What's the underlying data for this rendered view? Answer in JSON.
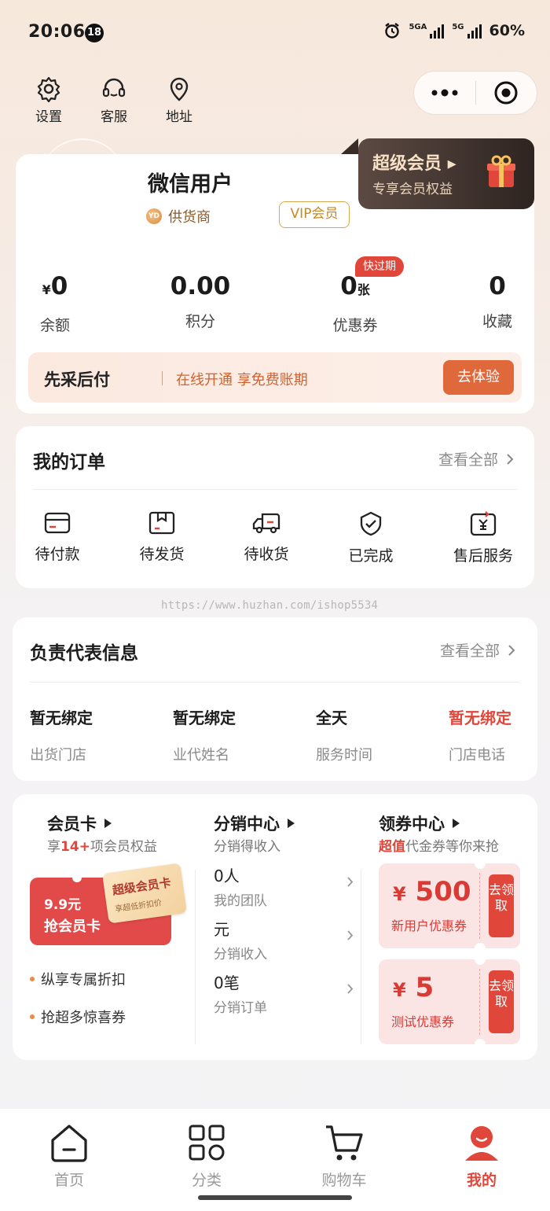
{
  "status_bar": {
    "time": "20:06",
    "badge": "18",
    "battery": "60%",
    "signal_label_1": "5GA",
    "signal_label_2": "5G"
  },
  "top_icons": [
    {
      "label": "设置",
      "icon": "gear-icon"
    },
    {
      "label": "客服",
      "icon": "headset-icon"
    },
    {
      "label": "地址",
      "icon": "location-pin-icon"
    }
  ],
  "user": {
    "name": "微信用户",
    "role": "供货商",
    "role_badge": "YD",
    "vip_tag": "VIP会员"
  },
  "super_vip": {
    "title": "超级会员",
    "subtitle": "专享会员权益"
  },
  "stats": [
    {
      "prefix": "¥",
      "value": "0",
      "suffix": "",
      "label": "余额"
    },
    {
      "prefix": "",
      "value": "0.00",
      "suffix": "",
      "label": "积分"
    },
    {
      "prefix": "",
      "value": "0",
      "suffix": "张",
      "label": "优惠券"
    },
    {
      "prefix": "",
      "value": "0",
      "suffix": "",
      "label": "收藏"
    }
  ],
  "expire_badge": "快过期",
  "pay_later": {
    "brand": "先采后付",
    "text": "在线开通 享免费账期",
    "button": "去体验"
  },
  "orders": {
    "title": "我的订单",
    "view_all": "查看全部",
    "items": [
      {
        "label": "待付款",
        "icon": "card-icon"
      },
      {
        "label": "待发货",
        "icon": "package-icon"
      },
      {
        "label": "待收货",
        "icon": "truck-icon"
      },
      {
        "label": "已完成",
        "icon": "shield-check-icon"
      },
      {
        "label": "售后服务",
        "icon": "refund-icon"
      }
    ]
  },
  "watermark": "https://www.huzhan.com/ishop5534",
  "representative": {
    "title": "负责代表信息",
    "view_all": "查看全部",
    "fields": [
      {
        "value": "暂无绑定",
        "label": "出货门店",
        "highlight": false
      },
      {
        "value": "暂无绑定",
        "label": "业代姓名",
        "highlight": false
      },
      {
        "value": "全天",
        "label": "服务时间",
        "highlight": false
      },
      {
        "value": "暂无绑定",
        "label": "门店电话",
        "highlight": true
      }
    ]
  },
  "member_card": {
    "title": "会员卡",
    "sub_prefix": "享",
    "sub_highlight": "14+",
    "sub_suffix": "项会员权益",
    "price": "9.9元",
    "grab": "抢会员卡",
    "sticker_title": "超级会员卡",
    "sticker_sub": "享超低折扣价",
    "perks": [
      "纵享专属折扣",
      "抢超多惊喜券"
    ]
  },
  "distribution": {
    "title": "分销中心",
    "subtitle": "分销得收入",
    "rows": [
      {
        "value": "0人",
        "label": "我的团队"
      },
      {
        "value": "元",
        "label": "分销收入"
      },
      {
        "value": "0笔",
        "label": "分销订单"
      }
    ]
  },
  "coupon_center": {
    "title": "领券中心",
    "sub_highlight": "超值",
    "sub_suffix": "代金券等你来抢",
    "coupons": [
      {
        "currency": "¥",
        "amount": "500",
        "name": "新用户优惠券",
        "action": "去领取"
      },
      {
        "currency": "¥",
        "amount": "5",
        "name": "测试优惠券",
        "action": "去领取"
      }
    ]
  },
  "tabbar": [
    {
      "label": "首页",
      "icon": "home-icon",
      "active": false
    },
    {
      "label": "分类",
      "icon": "grid-icon",
      "active": false
    },
    {
      "label": "购物车",
      "icon": "cart-icon",
      "active": false
    },
    {
      "label": "我的",
      "icon": "user-icon",
      "active": true
    }
  ],
  "colors": {
    "accent": "#e0463a",
    "orange": "#e0693c",
    "gold": "#c58a24"
  }
}
